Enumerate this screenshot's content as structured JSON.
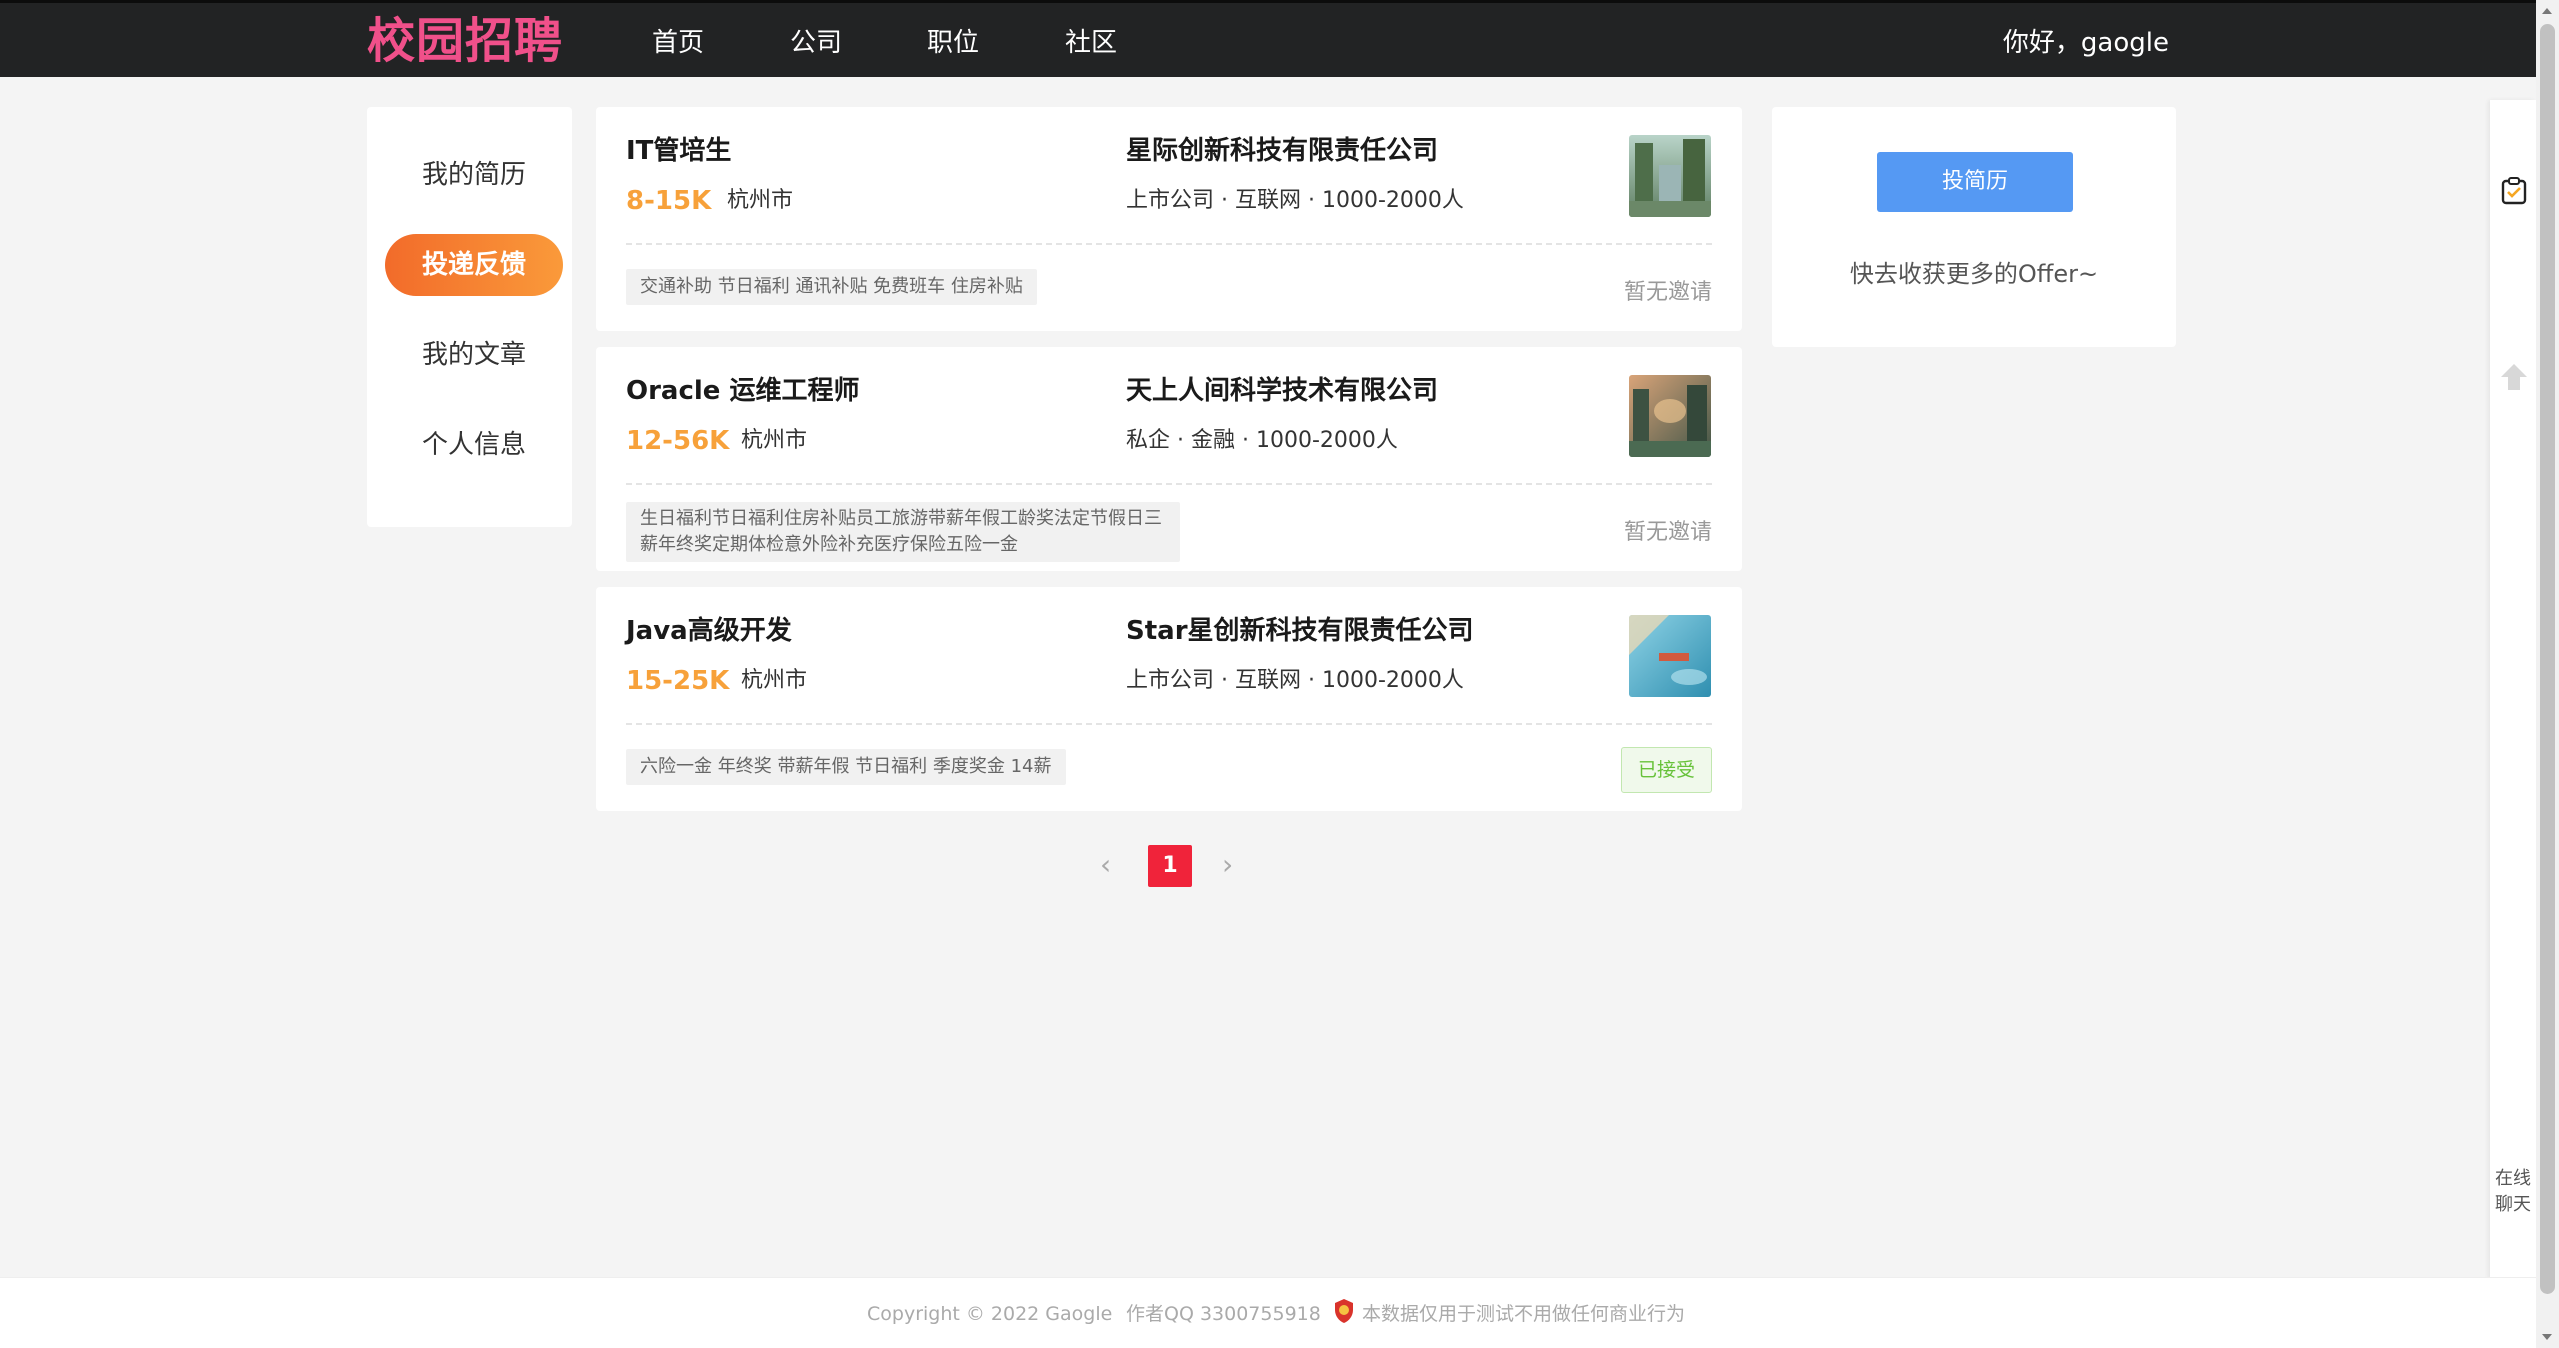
{
  "brand": "校园招聘",
  "nav": [
    "首页",
    "公司",
    "职位",
    "社区"
  ],
  "greeting": "你好，gaogle",
  "sidebar_menu": [
    {
      "label": "我的简历",
      "active": false
    },
    {
      "label": "投递反馈",
      "active": true
    },
    {
      "label": "我的文章",
      "active": false
    },
    {
      "label": "个人信息",
      "active": false
    }
  ],
  "jobs": [
    {
      "title": "IT管培生",
      "salary": "8-15K",
      "city": "杭州市",
      "company": "星际创新科技有限责任公司",
      "company_info": "上市公司 · 互联网 · 1000-2000人",
      "tags": "交通补助 节日福利 通讯补贴 免费班车 住房补贴",
      "status": "暂无邀请"
    },
    {
      "title": "Oracle 运维工程师",
      "salary": "12-56K",
      "city": "杭州市",
      "company": "天上人间科学技术有限公司",
      "company_info": "私企 · 金融 · 1000-2000人",
      "tags": "生日福利节日福利住房补贴员工旅游带薪年假工龄奖法定节假日三薪年终奖定期体检意外险补充医疗保险五险一金",
      "status": "暂无邀请"
    },
    {
      "title": "Java高级开发",
      "salary": "15-25K",
      "city": "杭州市",
      "company": "Star星创新科技有限责任公司",
      "company_info": "上市公司 · 互联网 · 1000-2000人",
      "tags": "六险一金 年终奖 带薪年假 节日福利 季度奖金 14薪",
      "status": "已接受"
    }
  ],
  "pagination": {
    "prev": "‹",
    "current": "1",
    "next": "›"
  },
  "right_panel": {
    "button": "投简历",
    "tip": "快去收获更多的Offer~"
  },
  "float_bar": {
    "chat_label_1": "在线",
    "chat_label_2": "聊天"
  },
  "footer": {
    "copyright": "Copyright © 2022 Gaogle",
    "qq": "作者QQ 3300755918",
    "disclaimer": "本数据仅用于测试不用做任何商业行为"
  },
  "colors": {
    "brand": "#f0508a",
    "salary": "#f7a13a",
    "active_menu": "#f26b2a",
    "primary_button": "#5599f3",
    "page_active": "#f0233a",
    "accepted": "#67c23a"
  }
}
